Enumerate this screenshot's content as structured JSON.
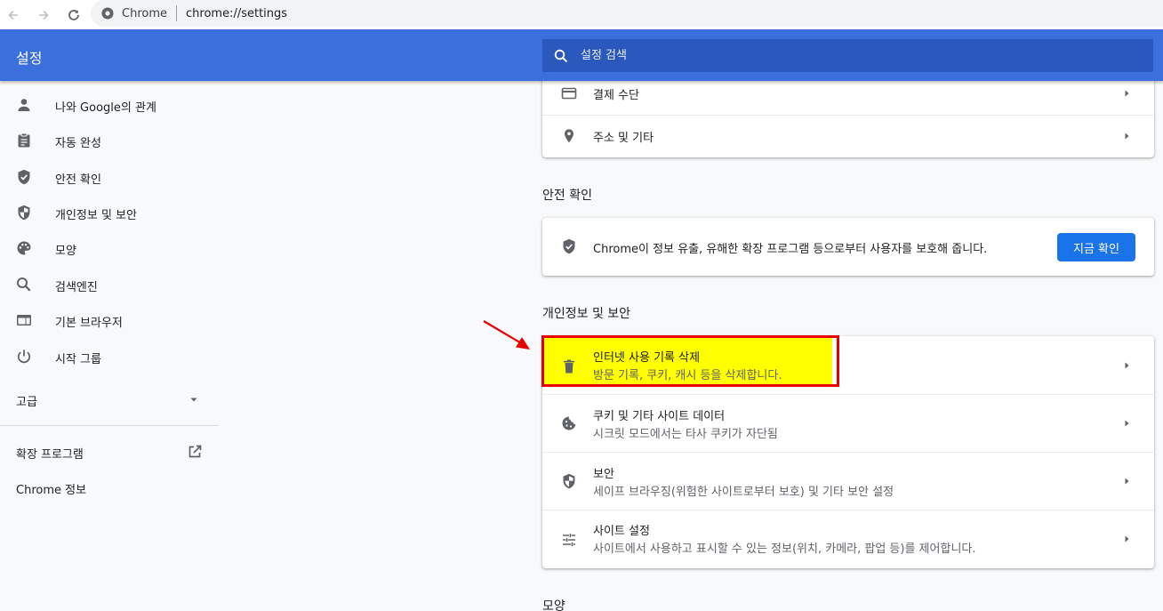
{
  "browser": {
    "origin": "Chrome",
    "url": "chrome://settings"
  },
  "header": {
    "title": "설정",
    "search_placeholder": "설정 검색"
  },
  "sidebar": {
    "items": [
      {
        "label": "나와 Google의 관계",
        "icon": "person-icon"
      },
      {
        "label": "자동 완성",
        "icon": "clipboard-icon"
      },
      {
        "label": "안전 확인",
        "icon": "shield-check-icon"
      },
      {
        "label": "개인정보 및 보안",
        "icon": "shield-half-icon"
      },
      {
        "label": "모양",
        "icon": "palette-icon"
      },
      {
        "label": "검색엔진",
        "icon": "search-icon"
      },
      {
        "label": "기본 브라우저",
        "icon": "browser-window-icon"
      },
      {
        "label": "시작 그룹",
        "icon": "power-icon"
      }
    ],
    "advanced_label": "고급",
    "extensions_label": "확장 프로그램",
    "about_label": "Chrome 정보"
  },
  "autofill_card": {
    "rows": [
      {
        "title": "결제 수단",
        "icon": "credit-card-icon"
      },
      {
        "title": "주소 및 기타",
        "icon": "location-pin-icon"
      }
    ]
  },
  "safety_check": {
    "section_title": "안전 확인",
    "description": "Chrome이 정보 유출, 유해한 확장 프로그램 등으로부터 사용자를 보호해 줍니다.",
    "button_label": "지금 확인"
  },
  "privacy": {
    "section_title": "개인정보 및 보안",
    "rows": [
      {
        "title": "인터넷 사용 기록 삭제",
        "subtitle": "방문 기록, 쿠키, 캐시 등을 삭제합니다.",
        "icon": "trash-icon"
      },
      {
        "title": "쿠키 및 기타 사이트 데이터",
        "subtitle": "시크릿 모드에서는 타사 쿠키가 자단됨",
        "icon": "cookie-icon"
      },
      {
        "title": "보안",
        "subtitle": "세이프 브라우징(위험한 사이트로부터 보호) 및 기타 보안 설정",
        "icon": "shield-half-icon"
      },
      {
        "title": "사이트 설정",
        "subtitle": "사이트에서 사용하고 표시할 수 있는 정보(위치, 카메라, 팝업 등)를 제어합니다.",
        "icon": "sliders-icon"
      }
    ]
  },
  "appearance": {
    "section_title": "모양"
  },
  "colors": {
    "header_bg": "#3b6fdb",
    "accent": "#1a73e8",
    "highlight": "#ffff00",
    "annotation": "#e60000"
  }
}
